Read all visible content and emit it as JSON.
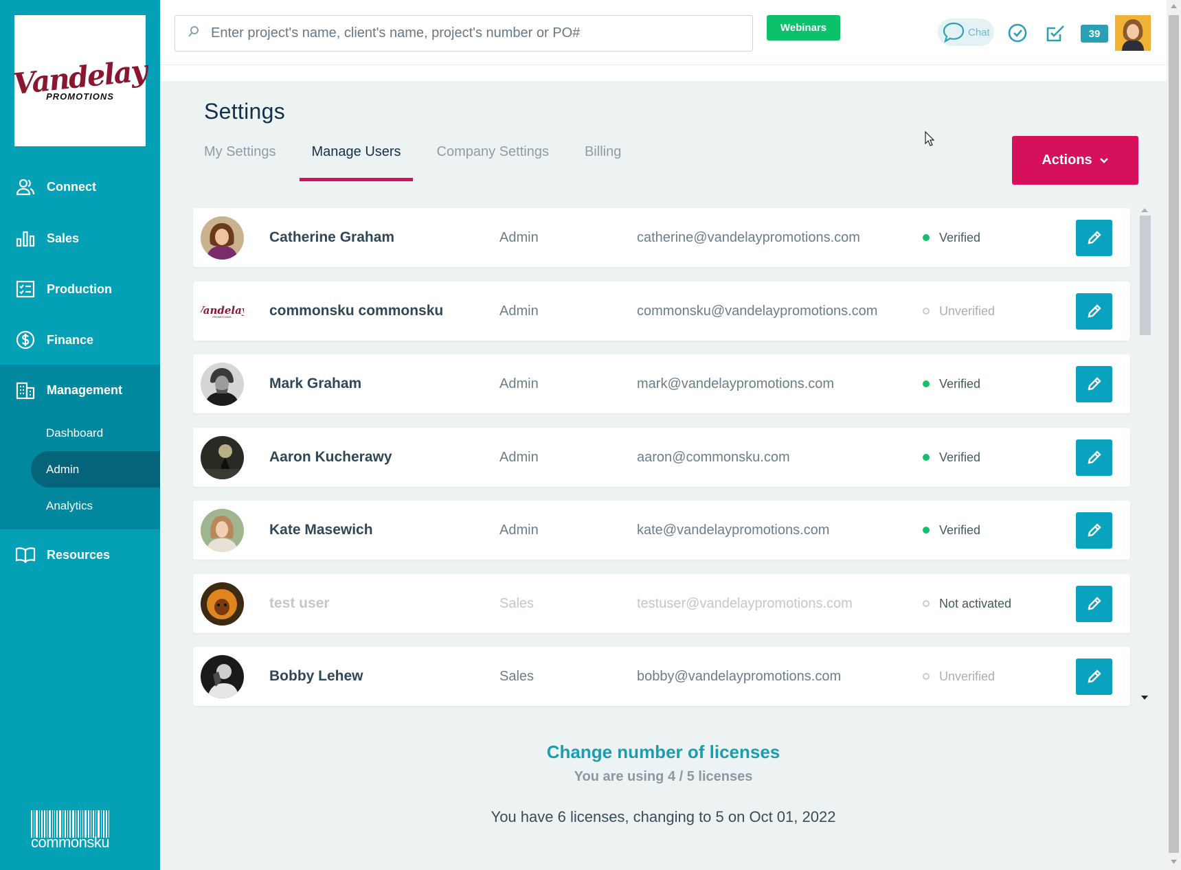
{
  "brand": {
    "logo_main": "Vandelay",
    "logo_sub": "PROMOTIONS",
    "footer_name": "commonsku"
  },
  "sidebar": {
    "items": [
      {
        "label": "Connect",
        "icon": "people-icon"
      },
      {
        "label": "Sales",
        "icon": "bar-chart-icon"
      },
      {
        "label": "Production",
        "icon": "checklist-icon"
      },
      {
        "label": "Finance",
        "icon": "dollar-icon"
      },
      {
        "label": "Management",
        "icon": "building-icon"
      },
      {
        "label": "Resources",
        "icon": "book-icon"
      }
    ],
    "management_sub": [
      {
        "label": "Dashboard"
      },
      {
        "label": "Admin"
      },
      {
        "label": "Analytics"
      }
    ]
  },
  "topbar": {
    "search_placeholder": "Enter project's name, client's name, project's number or PO#",
    "webinars_label": "Webinars",
    "chat_label": "Chat",
    "notification_count": "39"
  },
  "page": {
    "title": "Settings",
    "tabs": [
      {
        "label": "My Settings"
      },
      {
        "label": "Manage Users"
      },
      {
        "label": "Company Settings"
      },
      {
        "label": "Billing"
      }
    ],
    "active_tab": "Manage Users",
    "actions_label": "Actions"
  },
  "users": [
    {
      "name": "Catherine Graham",
      "role": "Admin",
      "email": "catherine@vandelaypromotions.com",
      "status": "Verified"
    },
    {
      "name": "commonsku commonsku",
      "role": "Admin",
      "email": "commonsku@vandelaypromotions.com",
      "status": "Unverified"
    },
    {
      "name": "Mark Graham",
      "role": "Admin",
      "email": "mark@vandelaypromotions.com",
      "status": "Verified"
    },
    {
      "name": "Aaron Kucherawy",
      "role": "Admin",
      "email": "aaron@commonsku.com",
      "status": "Verified"
    },
    {
      "name": "Kate Masewich",
      "role": "Admin",
      "email": "kate@vandelaypromotions.com",
      "status": "Verified"
    },
    {
      "name": "test user",
      "role": "Sales",
      "email": "testuser@vandelaypromotions.com",
      "status": "Not activated"
    },
    {
      "name": "Bobby Lehew",
      "role": "Sales",
      "email": "bobby@vandelaypromotions.com",
      "status": "Unverified"
    }
  ],
  "licenses": {
    "change_link": "Change number of licenses",
    "using_text": "You are using 4 / 5 licenses",
    "note": "You have 6 licenses, changing to 5 on Oct 01, 2022"
  },
  "colors": {
    "sidebar": "#04a0b6",
    "accent_pink": "#d6105a",
    "edit_button": "#0aa3bf",
    "verified": "#13c06c",
    "webinars": "#0bc26a"
  }
}
